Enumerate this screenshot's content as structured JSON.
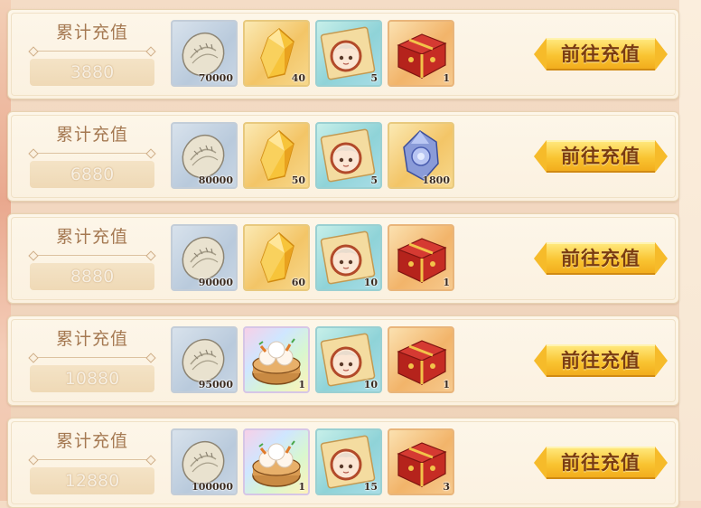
{
  "tiers": [
    {
      "label": "累计充值",
      "amount": "3880",
      "button": "前往充值",
      "rewards": [
        {
          "icon": "dumpling-icon",
          "quality": "blue",
          "count": "70000"
        },
        {
          "icon": "gold-crystal-icon",
          "quality": "gold",
          "count": "40"
        },
        {
          "icon": "character-card-icon",
          "quality": "teal",
          "count": "5"
        },
        {
          "icon": "red-gift-box-icon",
          "quality": "red",
          "count": "1"
        }
      ]
    },
    {
      "label": "累计充值",
      "amount": "6880",
      "button": "前往充值",
      "rewards": [
        {
          "icon": "dumpling-icon",
          "quality": "blue",
          "count": "80000"
        },
        {
          "icon": "gold-crystal-icon",
          "quality": "gold",
          "count": "50"
        },
        {
          "icon": "character-card-icon",
          "quality": "teal",
          "count": "5"
        },
        {
          "icon": "blue-gem-icon",
          "quality": "gold",
          "count": "1800"
        }
      ]
    },
    {
      "label": "累计充值",
      "amount": "8880",
      "button": "前往充值",
      "rewards": [
        {
          "icon": "dumpling-icon",
          "quality": "blue",
          "count": "90000"
        },
        {
          "icon": "gold-crystal-icon",
          "quality": "gold",
          "count": "60"
        },
        {
          "icon": "character-card-icon",
          "quality": "teal",
          "count": "10"
        },
        {
          "icon": "red-gift-box-icon",
          "quality": "red",
          "count": "1"
        }
      ]
    },
    {
      "label": "累计充值",
      "amount": "10880",
      "button": "前往充值",
      "rewards": [
        {
          "icon": "dumpling-icon",
          "quality": "blue",
          "count": "95000"
        },
        {
          "icon": "steamer-buns-icon",
          "quality": "rainbow",
          "count": "1"
        },
        {
          "icon": "character-card-icon",
          "quality": "teal",
          "count": "10"
        },
        {
          "icon": "red-gift-box-icon",
          "quality": "red",
          "count": "1"
        }
      ]
    },
    {
      "label": "累计充值",
      "amount": "12880",
      "button": "前往充值",
      "rewards": [
        {
          "icon": "dumpling-icon",
          "quality": "blue",
          "count": "100000"
        },
        {
          "icon": "steamer-buns-icon",
          "quality": "rainbow",
          "count": "1"
        },
        {
          "icon": "character-card-icon",
          "quality": "teal",
          "count": "15"
        },
        {
          "icon": "red-gift-box-icon",
          "quality": "red",
          "count": "3"
        }
      ]
    }
  ],
  "colors": {
    "button": "#f9c431",
    "label": "#a57952",
    "amount_bg": "#efd9b6"
  }
}
